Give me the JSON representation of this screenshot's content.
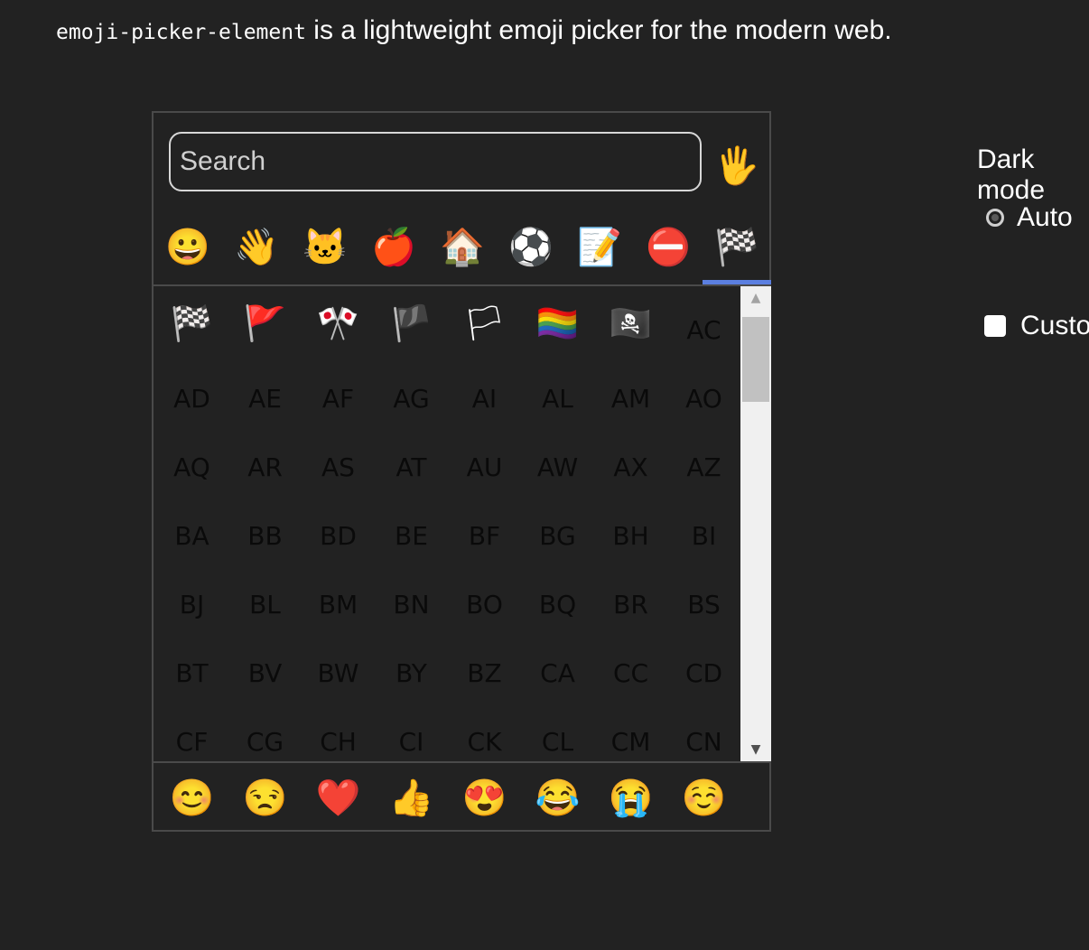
{
  "intro": {
    "code": "emoji-picker-element",
    "text": " is a lightweight emoji picker for the modern web."
  },
  "picker": {
    "search_placeholder": "Search",
    "skintone": "🖐",
    "tabs": [
      "😀",
      "👋",
      "🐱",
      "🍎",
      "🏠",
      "⚽",
      "📝",
      "⛔",
      "🏁"
    ],
    "grid": [
      "🏁",
      "🚩",
      "🎌",
      "🏴",
      "🏳",
      "🏳️‍🌈",
      "🏴‍☠️",
      "AC",
      "AD",
      "AE",
      "AF",
      "AG",
      "AI",
      "AL",
      "AM",
      "AO",
      "AQ",
      "AR",
      "AS",
      "AT",
      "AU",
      "AW",
      "AX",
      "AZ",
      "BA",
      "BB",
      "BD",
      "BE",
      "BF",
      "BG",
      "BH",
      "BI",
      "BJ",
      "BL",
      "BM",
      "BN",
      "BO",
      "BQ",
      "BR",
      "BS",
      "BT",
      "BV",
      "BW",
      "BY",
      "BZ",
      "CA",
      "CC",
      "CD",
      "CF",
      "CG",
      "CH",
      "CI",
      "CK",
      "CL",
      "CM",
      "CN"
    ],
    "favorites": [
      "😊",
      "😒",
      "❤️",
      "👍",
      "😍",
      "😂",
      "😭",
      "☺️"
    ],
    "indicator_color": "#5b7fe0"
  },
  "settings": {
    "dark_mode_title": "Dark mode",
    "auto_label": "Auto",
    "custom_label": "Custom"
  }
}
